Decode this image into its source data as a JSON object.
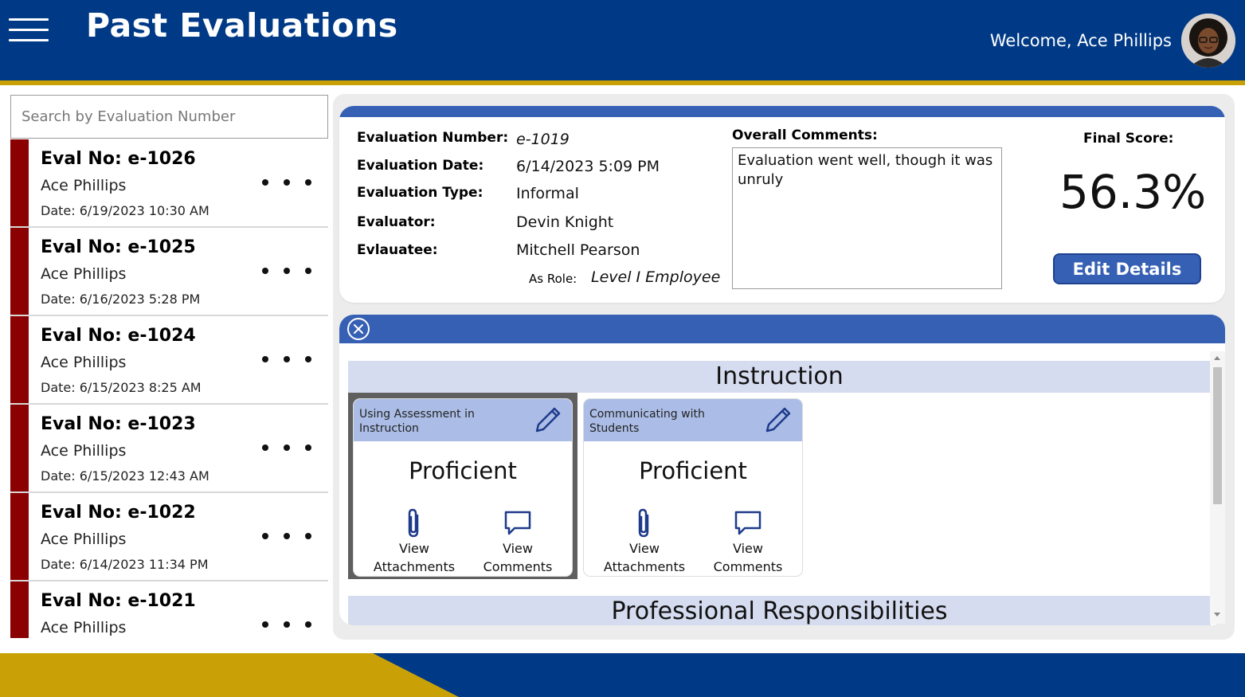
{
  "header": {
    "title": "Past Evaluations",
    "welcome": "Welcome, Ace Phillips"
  },
  "search": {
    "placeholder": "Search by Evaluation Number",
    "value": ""
  },
  "evaluations": [
    {
      "eval_no": "Eval No: e-1026",
      "person": "Ace Phillips",
      "date": "Date: 6/19/2023 10:30 AM"
    },
    {
      "eval_no": "Eval No: e-1025",
      "person": "Ace Phillips",
      "date": "Date: 6/16/2023 5:28 PM"
    },
    {
      "eval_no": "Eval No: e-1024",
      "person": "Ace Phillips",
      "date": "Date: 6/15/2023 8:25 AM"
    },
    {
      "eval_no": "Eval No: e-1023",
      "person": "Ace Phillips",
      "date": "Date: 6/15/2023 12:43 AM"
    },
    {
      "eval_no": "Eval No: e-1022",
      "person": "Ace Phillips",
      "date": "Date: 6/14/2023 11:34 PM"
    },
    {
      "eval_no": "Eval No: e-1021",
      "person": "Ace Phillips",
      "date": ""
    }
  ],
  "details": {
    "number_label": "Evaluation Number:",
    "number_value": "e-1019",
    "date_label": "Evaluation Date:",
    "date_value": "6/14/2023 5:09 PM",
    "type_label": "Evaluation Type:",
    "type_value": "Informal",
    "evaluator_label": "Evaluator:",
    "evaluator_value": "Devin Knight",
    "evaluatee_label": "Evlauatee:",
    "evaluatee_value": "Mitchell Pearson",
    "role_label": "As Role:",
    "role_value": "Level I Employee",
    "comments_label": "Overall Comments:",
    "comments_value": "Evaluation went well, though it was unruly",
    "score_label": "Final Score:",
    "score_value": "56.3%",
    "edit_button": "Edit Details"
  },
  "ratings": {
    "sections": [
      {
        "name": "Instruction",
        "cards": [
          {
            "title": "Using Assessment in Instruction",
            "rating": "Proficient",
            "attachments_label_1": "View",
            "attachments_label_2": "Attachments",
            "comments_label_1": "View",
            "comments_label_2": "Comments"
          },
          {
            "title": "Communicating with Students",
            "rating": "Proficient",
            "attachments_label_1": "View",
            "attachments_label_2": "Attachments",
            "comments_label_1": "View",
            "comments_label_2": "Comments"
          }
        ]
      },
      {
        "name": "Professional Responsibilities"
      }
    ]
  },
  "colors": {
    "primary_blue": "#003a86",
    "accent_blue": "#3660b4",
    "gold": "#c9a106",
    "status_red": "#8b0000",
    "card_header": "#abbde6",
    "section_header": "#d6dcef"
  },
  "icons": {
    "menu": "hamburger-icon",
    "close": "close-circle-icon",
    "edit": "pencil-icon",
    "attachments": "paperclip-icon",
    "comments": "speech-bubble-icon",
    "more": "more-dots-icon"
  }
}
